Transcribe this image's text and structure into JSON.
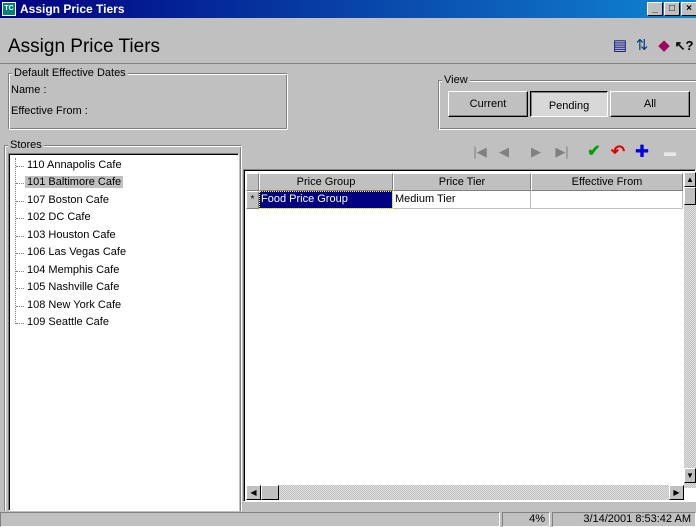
{
  "window": {
    "title": "Assign Price Tiers",
    "app_icon_text": "TC",
    "minimize_glyph": "_",
    "maximize_glyph": "□",
    "close_glyph": "×"
  },
  "header": {
    "page_title": "Assign Price Tiers",
    "icons": [
      {
        "name": "document-icon",
        "glyph": "▤"
      },
      {
        "name": "refresh-icon",
        "glyph": "⇅"
      },
      {
        "name": "book-icon",
        "glyph": "◆"
      },
      {
        "name": "help-icon",
        "glyph": "↖?"
      }
    ]
  },
  "defaults_group": {
    "legend": "Default Effective Dates",
    "name_label": "Name :",
    "effective_from_label": "Effective From :"
  },
  "view_group": {
    "legend": "View",
    "buttons": [
      {
        "label": "Current",
        "pressed": false
      },
      {
        "label": "Pending",
        "pressed": true
      },
      {
        "label": "All",
        "pressed": false
      }
    ]
  },
  "stores_group": {
    "legend": "Stores",
    "items": [
      {
        "label": "110 Annapolis Cafe",
        "selected": false
      },
      {
        "label": "101 Baltimore Cafe",
        "selected": true
      },
      {
        "label": "107 Boston Cafe",
        "selected": false
      },
      {
        "label": "102 DC Cafe",
        "selected": false
      },
      {
        "label": "103 Houston Cafe",
        "selected": false
      },
      {
        "label": "106 Las Vegas Cafe",
        "selected": false
      },
      {
        "label": "104 Memphis Cafe",
        "selected": false
      },
      {
        "label": "105 Nashville Cafe",
        "selected": false
      },
      {
        "label": "108 New York Cafe",
        "selected": false
      },
      {
        "label": "109 Seattle Cafe",
        "selected": false
      }
    ]
  },
  "toolbar": {
    "buttons": [
      {
        "name": "first-record-icon",
        "glyph": "|◀",
        "color": "#808080"
      },
      {
        "name": "previous-record-icon",
        "glyph": "◀",
        "color": "#808080"
      },
      {
        "name": "next-record-icon",
        "glyph": "▶",
        "color": "#808080"
      },
      {
        "name": "last-record-icon",
        "glyph": "▶|",
        "color": "#808080"
      },
      {
        "name": "save-check-icon",
        "glyph": "✔",
        "color": "#00a000"
      },
      {
        "name": "undo-icon",
        "glyph": "↶",
        "color": "#e00000"
      },
      {
        "name": "add-icon",
        "glyph": "✚",
        "color": "#0000e0"
      },
      {
        "name": "delete-icon",
        "glyph": "▬",
        "color": "#a0a0a0"
      }
    ]
  },
  "grid": {
    "columns": [
      "Price Group",
      "Price Tier",
      "Effective From"
    ],
    "rows": [
      {
        "indicator": "*",
        "cells": [
          "Food Price Group",
          "Medium Tier",
          ""
        ]
      }
    ]
  },
  "statusbar": {
    "message": "",
    "percent": "4%",
    "datetime": "3/14/2001 8:53:42 AM"
  },
  "colors": {
    "titlebar_start": "#000080",
    "titlebar_end": "#1084d0",
    "selection": "#000080",
    "face": "#c0c0c0"
  }
}
